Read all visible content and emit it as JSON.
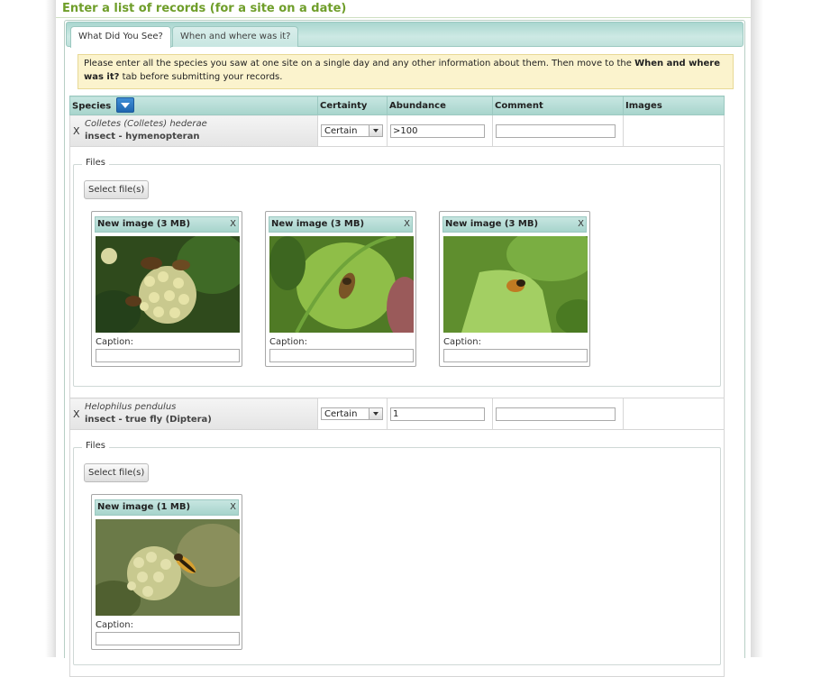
{
  "section_title": "Enter a list of records (for a site on a date)",
  "tabs": [
    {
      "label": "What Did You See?",
      "active": true
    },
    {
      "label": "When and where was it?",
      "active": false
    }
  ],
  "info": {
    "text_start": "Please enter all the species you saw at one site on a single day and any other information about them. Then move to the ",
    "bold": "When and where was it?",
    "text_end": " tab before submitting your records."
  },
  "grid": {
    "headers": {
      "species": "Species",
      "certainty": "Certainty",
      "abundance": "Abundance",
      "comment": "Comment",
      "images": "Images"
    },
    "rows": [
      {
        "remove": "X",
        "name": "Colletes (Colletes) hederae",
        "group": "insect - hymenopteran",
        "certainty": "Certain",
        "abundance": ">100",
        "comment": "",
        "files_legend": "Files",
        "select_files": "Select file(s)",
        "images": [
          {
            "title": "New image (3 MB)",
            "close": "X",
            "caption_label": "Caption:",
            "caption": ""
          },
          {
            "title": "New image (3 MB)",
            "close": "X",
            "caption_label": "Caption:",
            "caption": ""
          },
          {
            "title": "New image (3 MB)",
            "close": "X",
            "caption_label": "Caption:",
            "caption": ""
          }
        ]
      },
      {
        "remove": "X",
        "name": "Helophilus pendulus",
        "group": "insect - true fly (Diptera)",
        "certainty": "Certain",
        "abundance": "1",
        "comment": "",
        "files_legend": "Files",
        "select_files": "Select file(s)",
        "images": [
          {
            "title": "New image (1 MB)",
            "close": "X",
            "caption_label": "Caption:",
            "caption": ""
          }
        ]
      }
    ]
  },
  "colors": {
    "title_green": "#6f9e2a",
    "header_teal": "#a7d4cc",
    "info_bg": "#fbf3cd",
    "dropdown_blue": "#1f66b0"
  }
}
